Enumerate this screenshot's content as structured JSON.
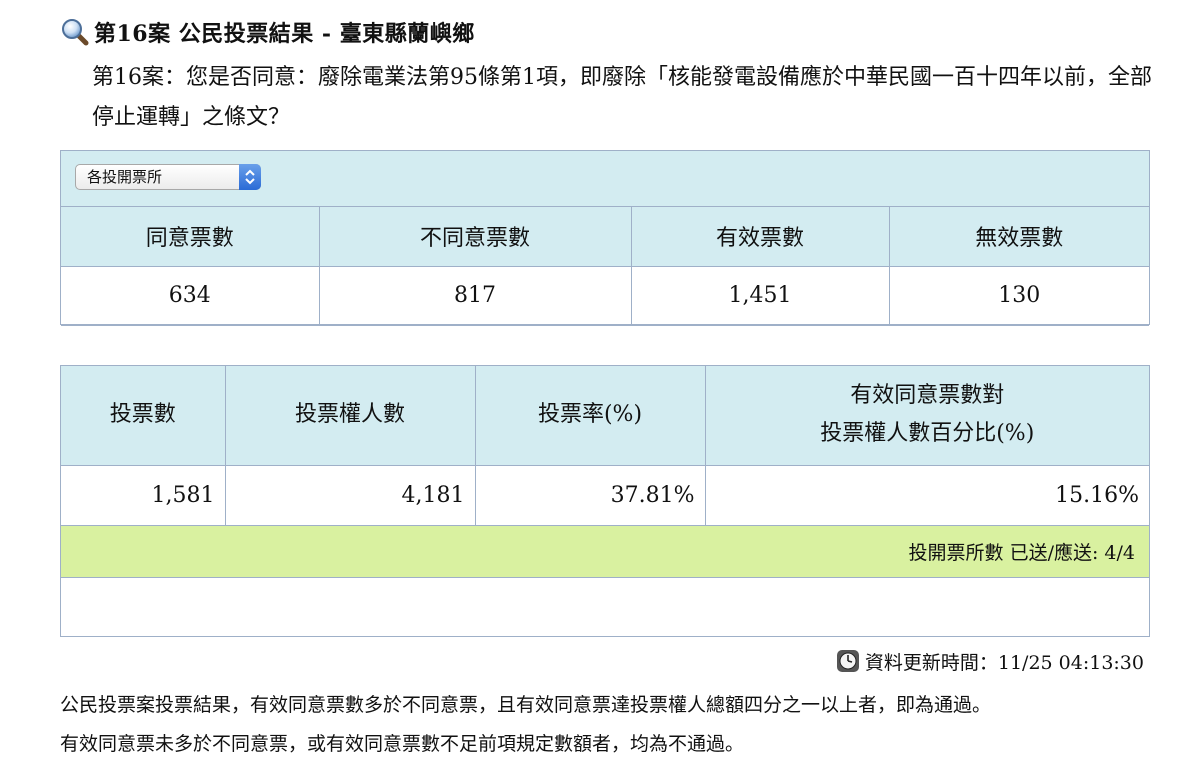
{
  "header": {
    "title": "第16案 公民投票結果 - 臺東縣蘭嶼鄉",
    "icon": "magnifier-icon"
  },
  "question": "第16案：您是否同意：廢除電業法第95條第1項，即廢除「核能發電設備應於中華民國一百十四年以前，全部停止運轉」之條文？",
  "selector": {
    "selected": "各投開票所",
    "icon": "select-arrows-icon"
  },
  "votes": {
    "headers": [
      "同意票數",
      "不同意票數",
      "有效票數",
      "無效票數"
    ],
    "values": [
      "634",
      "817",
      "1,451",
      "130"
    ]
  },
  "turnout": {
    "headers": [
      "投票數",
      "投票權人數",
      "投票率(%)",
      "有效同意票數對",
      "投票權人數百分比(%)"
    ],
    "values": [
      "1,581",
      "4,181",
      "37.81%",
      "15.16%"
    ]
  },
  "stations": "投開票所數 已送/應送: 4/4",
  "update": {
    "label": "資料更新時間：11/25 04:13:30",
    "icon": "clock-icon"
  },
  "notes": [
    "公民投票案投票結果，有效同意票數多於不同意票，且有效同意票達投票權人總額四分之一以上者，即為通過。",
    "有效同意票未多於不同意票，或有效同意票數不足前項規定數額者，均為不通過。"
  ],
  "colors": {
    "header_bg": "#d3ecf1",
    "status_bg": "#d9f1a0",
    "border": "#9fb0c8",
    "select_accent": "#2a6bd6"
  }
}
